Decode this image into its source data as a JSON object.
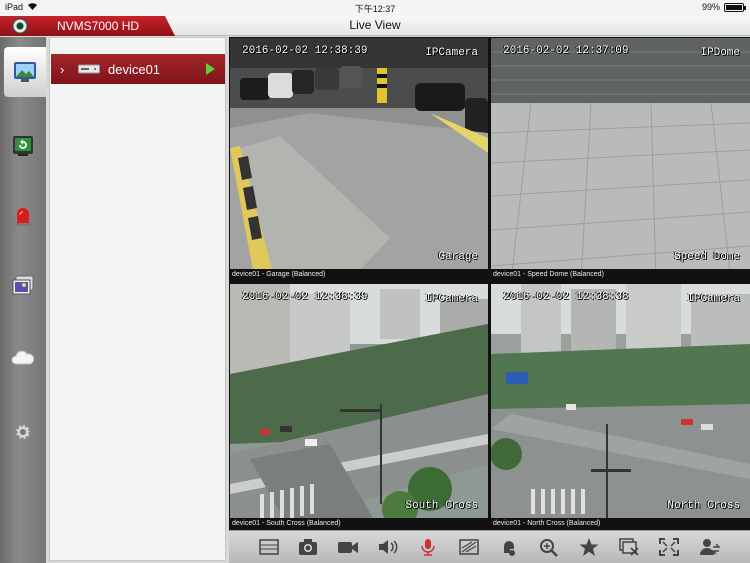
{
  "status_bar": {
    "device": "iPad",
    "time": "下午12:37",
    "battery": "99%",
    "battery_level": 0.99
  },
  "app": {
    "name": "NVMS7000 HD",
    "page_title": "Live View"
  },
  "sidebar": {
    "items": [
      {
        "icon": "live-view-icon",
        "active": true
      },
      {
        "icon": "playback-icon",
        "active": false
      },
      {
        "icon": "alarm-light-icon",
        "active": false
      },
      {
        "icon": "pictures-icon",
        "active": false
      },
      {
        "icon": "cloud-icon",
        "active": false
      },
      {
        "icon": "settings-gear-icon",
        "active": false
      }
    ]
  },
  "device_list": {
    "devices": [
      {
        "name": "device01"
      }
    ]
  },
  "video_tiles": [
    {
      "timestamp": "2016-02-02 12:38:39",
      "camera_type": "IPCamera",
      "camera_name": "Garage",
      "caption": "device01 - Garage (Balanced)",
      "selected": true
    },
    {
      "timestamp": "2016-02-02 12:37:09",
      "camera_type": "IPDome",
      "camera_name": "Speed Dome",
      "caption": "device01 - Speed Dome (Balanced)",
      "selected": false
    },
    {
      "timestamp": "2016-02-02 12:38:39",
      "camera_type": "IPCamera",
      "camera_name": "South Cross",
      "caption": "device01 - South Cross (Balanced)",
      "selected": false
    },
    {
      "timestamp": "2016-02-02 12:38:38",
      "camera_type": "IPCamera",
      "camera_name": "North Cross",
      "caption": "device01 - North Cross (Balanced)",
      "selected": false
    }
  ],
  "toolbar": {
    "buttons": [
      "window-layout-icon",
      "snapshot-camera-icon",
      "record-video-icon",
      "audio-speaker-icon",
      "microphone-talk-icon",
      "image-quality-icon",
      "ptz-control-icon",
      "digital-zoom-icon",
      "favorite-star-icon",
      "close-all-icon",
      "fullscreen-icon",
      "device-switch-icon"
    ]
  },
  "colors": {
    "brand_red": "#a3262b",
    "play_green": "#5bd23a",
    "selected_outline": "#c9a03b"
  }
}
